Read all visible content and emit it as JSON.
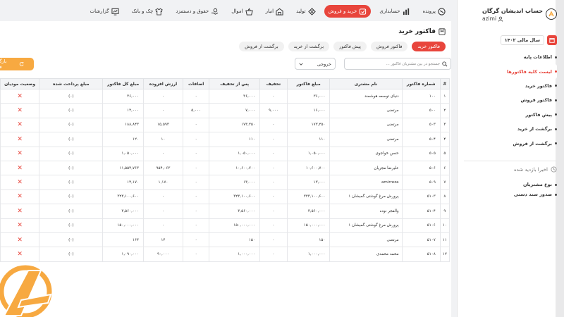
{
  "topnav": [
    {
      "label": "پرونده",
      "icon": "folder-icon",
      "active": false
    },
    {
      "label": "حسابداری",
      "icon": "chart-icon",
      "active": false
    },
    {
      "label": "خرید و فروش",
      "icon": "cart-icon",
      "active": true
    },
    {
      "label": "تولید",
      "icon": "gears-icon",
      "active": false
    },
    {
      "label": "انبار",
      "icon": "warehouse-icon",
      "active": false
    },
    {
      "label": "اموال",
      "icon": "basket-icon",
      "active": false
    },
    {
      "label": "حقوق و دستمزد",
      "icon": "hand-money-icon",
      "active": false
    },
    {
      "label": "چک و بانک",
      "icon": "shirt-icon",
      "active": false
    },
    {
      "label": "گزارشات",
      "icon": "report-icon",
      "active": false
    }
  ],
  "page": {
    "title": "فاکتور خرید",
    "tabs": [
      "فاکتور خرید",
      "فاکتور فروش",
      "پیش فاکتور",
      "برگشت از خرید",
      "برگشت از فروش"
    ],
    "active_tab": 0
  },
  "toolbar": {
    "search_placeholder": "جستجو در بین مشتریان فاکتور ...",
    "export_label": "خروجی",
    "reload_label": "بارگذاری فاکتور"
  },
  "table": {
    "headers": [
      "#",
      "شماره فاکتور",
      "نام مشتری",
      "مبلغ فاکتور",
      "تخفیف",
      "پس از تخفیف",
      "اضافات",
      "ارزش افزوده",
      "مبلغ کل فاکتور",
      "مبلغ پرداخت شده",
      "وضعیت مودیان"
    ],
    "rows": [
      [
        "۱",
        "۱۰۰",
        "دنیای توسعه هوشمند",
        "۳۶,۰۰۰",
        "۰",
        "۳۶,۰۰۰",
        "۰",
        "۰",
        "۳۶,۰۰۰",
        "(۰)",
        "✕"
      ],
      [
        "۲",
        "۵۰۰",
        "مرتضی",
        "۱۶,۰۰۰",
        "۹,۰۰۰",
        "۷,۰۰۰",
        "۵,۰۰۰",
        "۰",
        "۱۲,۰۰۰",
        "(۰)",
        "✕"
      ],
      [
        "۳",
        "۵۰۳",
        "مرتضی",
        "۱۷۳,۲۵۰",
        "۰",
        "۱۷۳,۲۵۰",
        "۰",
        "۱۵,۵۹۳",
        "۱۸۸,۸۴۳",
        "(۰)",
        "✕"
      ],
      [
        "۴",
        "۵۰۴",
        "مرتضی",
        "۱۱۰",
        "۰",
        "۱۱۰",
        "۰",
        "۱۰",
        "۱۲۰",
        "(۰)",
        "✕"
      ],
      [
        "۵",
        "۵۰۵",
        "حسن خواجوی",
        "۱,۰۵۰,۰۰۰",
        "۰",
        "۱,۰۵۰,۰۰۰",
        "۰",
        "۰",
        "۱,۰۵۰,۰۰۰",
        "(۰)",
        "✕"
      ],
      [
        "۶",
        "۵۰۶",
        "علیرضا مجریان",
        "۱۰,۶۰۰,۷۰۰",
        "۰",
        "۱۰,۶۰۰,۷۰۰",
        "۰",
        "۹۵۴,۰۶۳",
        "۱۱,۵۵۴,۷۶۳",
        "(۰)",
        "✕"
      ],
      [
        "۷",
        "۵۰۹",
        "amirreza",
        "۱۳,۰۰۰",
        "۰",
        "۱۳,۰۰۰",
        "۰",
        "۱,۱۷۰",
        "۱۴,۱۷۰",
        "(۰)",
        "✕"
      ],
      [
        "۸",
        "۵۱۰۳",
        "پرورش مرغ گوشتی گمیشان ۱",
        "۳۲۳,۱۰۰,۶۰۰",
        "۰",
        "۳۲۳,۱۰۰,۶۰۰",
        "۰",
        "۰",
        "۳۲۳,۱۰۰,۶۰۰",
        "(۰)",
        "✕"
      ],
      [
        "۹",
        "۵۱۰۴",
        "والفجر نوده",
        "۳,۵۶۰,۰۰۰",
        "۰",
        "۳,۵۶۰,۰۰۰",
        "۰",
        "۰",
        "۳,۵۶۰,۰۰۰",
        "(۰)",
        "✕"
      ],
      [
        "۱۰",
        "۵۱۰۶",
        "پرورش مرغ گوشتی گمیشان ۱",
        "۱۵۰,۰۰۰,۰۰۰",
        "۰",
        "۱۵۰,۰۰۰,۰۰۰",
        "۰",
        "۰",
        "۱۵۰,۰۰۰,۰۰۰",
        "(۰)",
        "✕"
      ],
      [
        "۱۱",
        "۵۱۰۷",
        "مرتضی",
        "۱۵۰",
        "۰",
        "۱۵۰",
        "۰",
        "۱۴",
        "۱۶۴",
        "(۰)",
        "✕"
      ],
      [
        "۱۲",
        "۵۱۰۸",
        "محمد محمدی",
        "۱,۰۰۰,۰۰۰",
        "۰",
        "۱,۰۰۰,۰۰۰",
        "۰",
        "۹۰,۰۰۰",
        "۱,۰۹۰,۰۰۰",
        "(۰)",
        "✕"
      ]
    ]
  },
  "sidebar": {
    "brand_name": "حساب اندیشان گرگان",
    "user": "azimi",
    "fiscal_year": "سال مالی ۱۴۰۲",
    "items": [
      {
        "label": "اطلاعات پایه",
        "active": false
      },
      {
        "label": "لیست کلیه فاکتورها",
        "active": true
      },
      {
        "label": "فاکتور خرید",
        "active": false
      },
      {
        "label": "فاکتور فروش",
        "active": false
      },
      {
        "label": "پیش فاکتور",
        "active": false
      },
      {
        "label": "برگشت از خرید",
        "active": false
      },
      {
        "label": "برگشت از فروش",
        "active": false
      }
    ],
    "recent_title": "اخیرا بازدید شده",
    "recent_items": [
      "نوع مشتریان",
      "صدور سند دستی"
    ]
  },
  "colors": {
    "accent": "#e8453c",
    "orange": "#f7a941",
    "header_bg": "#f3f4f6"
  }
}
